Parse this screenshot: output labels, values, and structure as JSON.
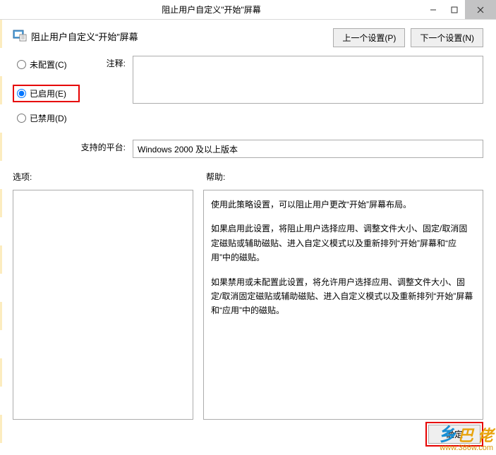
{
  "window": {
    "title": "阻止用户自定义\"开始\"屏幕"
  },
  "header": {
    "policy_title": "阻止用户自定义“开始”屏幕",
    "prev_btn": "上一个设置(P)",
    "next_btn": "下一个设置(N)"
  },
  "radio": {
    "not_configured": "未配置(C)",
    "enabled": "已启用(E)",
    "disabled": "已禁用(D)",
    "selected": "enabled"
  },
  "labels": {
    "comment": "注释:",
    "platform": "支持的平台:",
    "options": "选项:",
    "help": "帮助:"
  },
  "platform": {
    "text": "Windows 2000 及以上版本"
  },
  "help": {
    "p1": "使用此策略设置，可以阻止用户更改“开始”屏幕布局。",
    "p2": "如果启用此设置，将阻止用户选择应用、调整文件大小、固定/取消固定磁贴或辅助磁贴、进入自定义模式以及重新排列“开始”屏幕和“应用”中的磁贴。",
    "p3": "如果禁用或未配置此设置，将允许用户选择应用、调整文件大小、固定/取消固定磁贴或辅助磁贴、进入自定义模式以及重新排列“开始”屏幕和“应用”中的磁贴。"
  },
  "footer": {
    "ok": "确定"
  },
  "watermark": {
    "brand_a": "乡",
    "brand_b": "巴 佬",
    "url": "www.386w.com"
  }
}
